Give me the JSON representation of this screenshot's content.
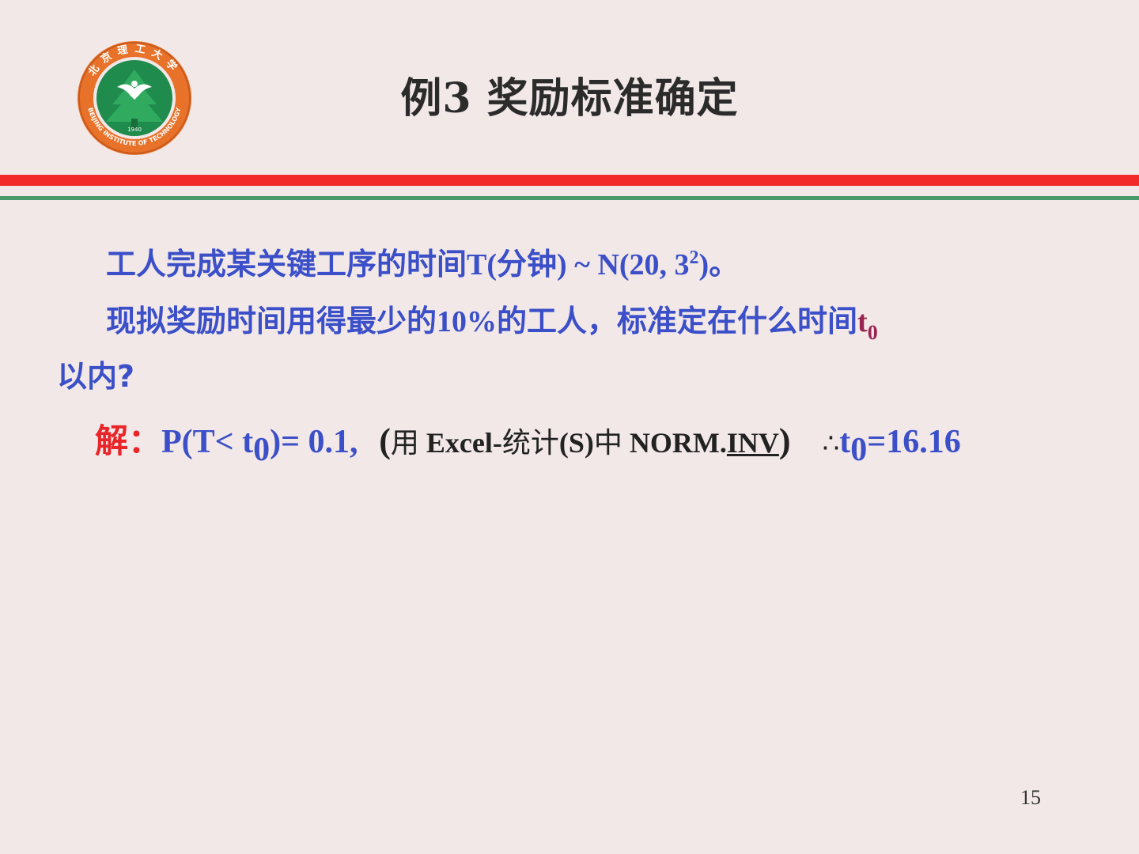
{
  "slide": {
    "title": "例3 奖励标准确定",
    "page_number": "15"
  },
  "logo": {
    "name_cn": "北京理工大学",
    "name_en": "BEIJING INSTITUTE OF TECHNOLOGY",
    "year": "1940",
    "colors": {
      "ring": "#e8722a",
      "inner": "#1f8c4e",
      "bird": "#ffffff"
    }
  },
  "rules": {
    "red": "#f22a2a",
    "green": "#4b9a6a"
  },
  "problem": {
    "line1_text": "工人完成某关键工序的时间",
    "line1_T": "T(",
    "line1_unit": "分钟",
    "line1_dist": ") ~ N(20, 3",
    "line1_exp": "2",
    "line1_end": ")。",
    "line2_text": "现拟奖励时间用得最少的",
    "line2_pct": "10%",
    "line2_text2": "的工人，标准定在什么时间",
    "line2_t": "t",
    "line2_sub": "0",
    "line3_text": "以内?"
  },
  "solution": {
    "label": "解：",
    "expr_a": "P(T< ",
    "expr_t": "t",
    "expr_sub": "0",
    "expr_b": ")= 0.1,",
    "note_open": "(",
    "note_yong": "用 ",
    "note_excel": "Excel-",
    "note_tongji": "统计",
    "note_s": "(S)",
    "note_zhong": "中 ",
    "note_norm": "NORM.",
    "note_inv": "INV",
    "note_close": ")",
    "therefore": "∴",
    "ans_t": "t",
    "ans_sub": "0",
    "ans_val": "=16.16"
  }
}
